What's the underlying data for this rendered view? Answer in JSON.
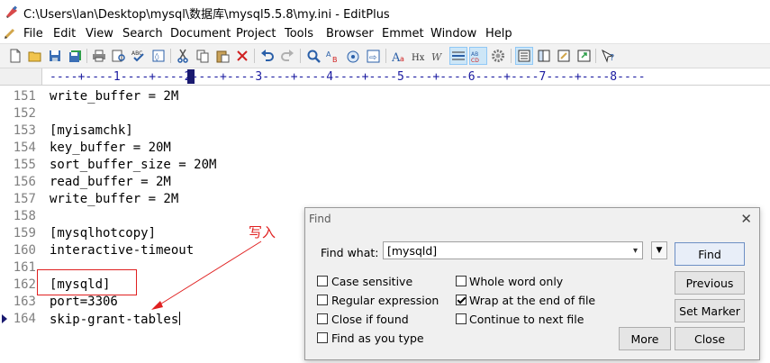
{
  "window": {
    "title": "C:\\Users\\lan\\Desktop\\mysql\\数据库\\mysql5.5.8\\my.ini - EditPlus"
  },
  "menu": [
    "File",
    "Edit",
    "View",
    "Search",
    "Document",
    "Project",
    "Tools",
    "Browser",
    "Emmet",
    "Window",
    "Help"
  ],
  "toolbar_icons": [
    "new-file-icon",
    "open-icon",
    "save-icon",
    "save-all-icon",
    "print-icon",
    "print-preview-icon",
    "spell-check-icon",
    "browser-view-icon",
    "cut-icon",
    "copy-icon",
    "paste-icon",
    "delete-icon",
    "undo-icon",
    "redo-icon",
    "find-icon",
    "replace-icon",
    "find-in-files-icon",
    "goto-icon",
    "font-size-icon",
    "hex-icon",
    "word-wrap-icon",
    "line-numbers-icon",
    "ruler-icon",
    "settings-icon",
    "cliptext-icon",
    "directory-icon",
    "output-window-icon",
    "full-screen-icon",
    "help-icon"
  ],
  "ruler": {
    "text": "----+----1----+----2----+----3----+----4----+----5----+----6----+----7----+----8----"
  },
  "editor": {
    "lines": [
      {
        "num": "151",
        "text": "write_buffer = 2M"
      },
      {
        "num": "152",
        "text": ""
      },
      {
        "num": "153",
        "text": "[myisamchk]"
      },
      {
        "num": "154",
        "text": "key_buffer = 20M"
      },
      {
        "num": "155",
        "text": "sort_buffer_size = 20M"
      },
      {
        "num": "156",
        "text": "read_buffer = 2M"
      },
      {
        "num": "157",
        "text": "write_buffer = 2M"
      },
      {
        "num": "158",
        "text": ""
      },
      {
        "num": "159",
        "text": "[mysqlhotcopy]"
      },
      {
        "num": "160",
        "text": "interactive-timeout"
      },
      {
        "num": "161",
        "text": ""
      },
      {
        "num": "162",
        "text": "[mysqld]"
      },
      {
        "num": "163",
        "text": "port=3306"
      },
      {
        "num": "164",
        "text": "skip-grant-tables"
      }
    ],
    "annotation": "写入",
    "annotation_color": "#e02020"
  },
  "find_dialog": {
    "title": "Find",
    "find_what_label": "Find what:",
    "find_what_value": "[mysqld]",
    "options": {
      "case_sensitive": {
        "label": "Case sensitive",
        "checked": false
      },
      "whole_word": {
        "label": "Whole word only",
        "checked": false
      },
      "regex": {
        "label": "Regular expression",
        "checked": false
      },
      "wrap": {
        "label": "Wrap at the end of file",
        "checked": true
      },
      "close_if_found": {
        "label": "Close if found",
        "checked": false
      },
      "continue_next": {
        "label": "Continue to next file",
        "checked": false
      },
      "find_as_you_type": {
        "label": "Find as you type",
        "checked": false
      }
    },
    "buttons": {
      "find": "Find",
      "previous": "Previous",
      "set_marker": "Set Marker",
      "more": "More",
      "close": "Close"
    }
  }
}
